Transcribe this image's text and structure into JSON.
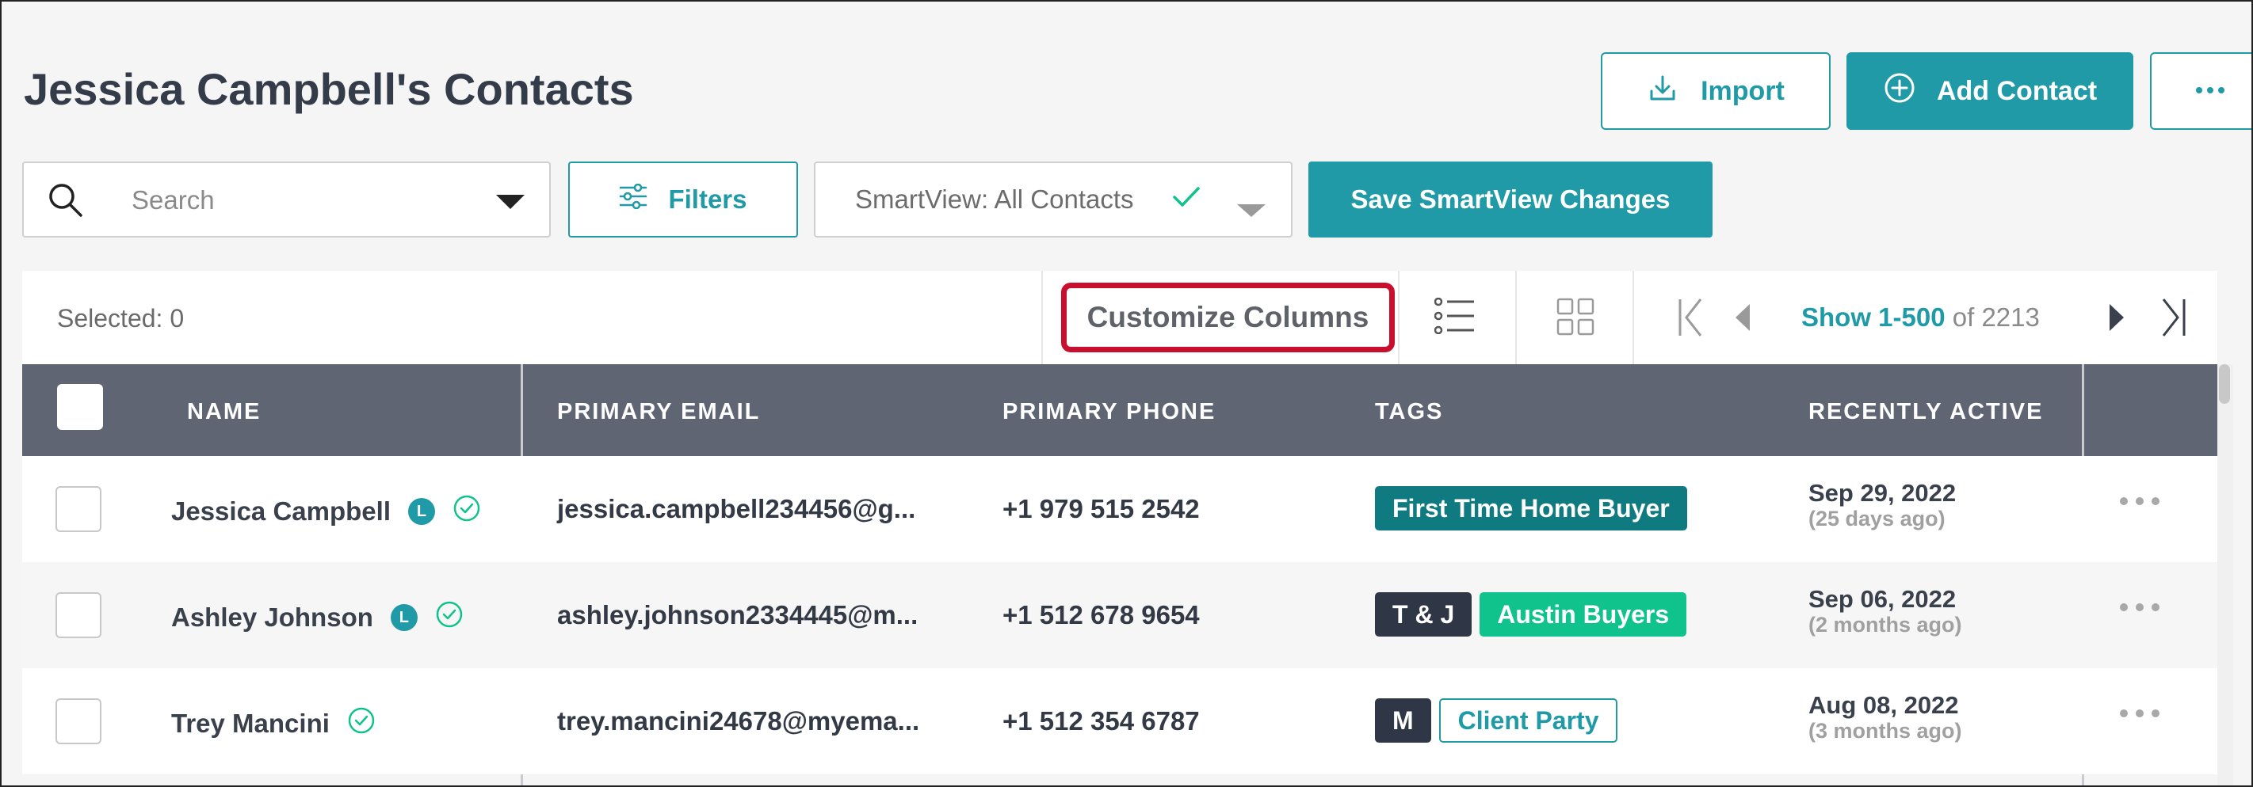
{
  "header": {
    "title": "Jessica Campbell's Contacts",
    "import_label": "Import",
    "add_contact_label": "Add Contact"
  },
  "toolbar": {
    "search_placeholder": "Search",
    "filters_label": "Filters",
    "smartview_label": "SmartView: All Contacts",
    "save_smartview_label": "Save SmartView Changes"
  },
  "table_toolbar": {
    "selected_label": "Selected: 0",
    "customize_columns_label": "Customize Columns",
    "pager_range": "Show 1-500",
    "pager_total": "of 2213"
  },
  "columns": [
    "NAME",
    "PRIMARY EMAIL",
    "PRIMARY PHONE",
    "TAGS",
    "RECENTLY ACTIVE"
  ],
  "rows": [
    {
      "name": "Jessica Campbell",
      "lead_badge": "L",
      "email": "jessica.campbell234456@g...",
      "phone": "+1 979 515 2542",
      "tags": [
        {
          "label": "First Time Home Buyer",
          "style": "teal-dark"
        }
      ],
      "active_date": "Sep 29, 2022",
      "active_ago": "(25 days ago)"
    },
    {
      "name": "Ashley Johnson",
      "lead_badge": "L",
      "email": "ashley.johnson2334445@m...",
      "phone": "+1 512 678 9654",
      "tags": [
        {
          "label": "T & J",
          "style": "navy"
        },
        {
          "label": "Austin Buyers",
          "style": "green"
        }
      ],
      "active_date": "Sep 06, 2022",
      "active_ago": "(2 months ago)"
    },
    {
      "name": "Trey Mancini",
      "lead_badge": "",
      "email": "trey.mancini24678@myema...",
      "phone": "+1 512 354 6787",
      "tags": [
        {
          "label": "M",
          "style": "navy"
        },
        {
          "label": "Client Party",
          "style": "outline"
        }
      ],
      "active_date": "Aug 08, 2022",
      "active_ago": "(3 months ago)"
    }
  ],
  "colors": {
    "accent": "#1f9aa6",
    "header_bg": "#5f6573",
    "highlight": "#c8102e"
  },
  "icons": [
    "import-icon",
    "plus-circle-icon",
    "ellipsis-icon",
    "search-icon",
    "dropdown-icon",
    "filter-sliders-icon",
    "check-icon",
    "list-view-icon",
    "grid-view-icon",
    "first-page-icon",
    "previous-page-icon",
    "next-page-icon",
    "last-page-icon",
    "verified-check-icon"
  ]
}
